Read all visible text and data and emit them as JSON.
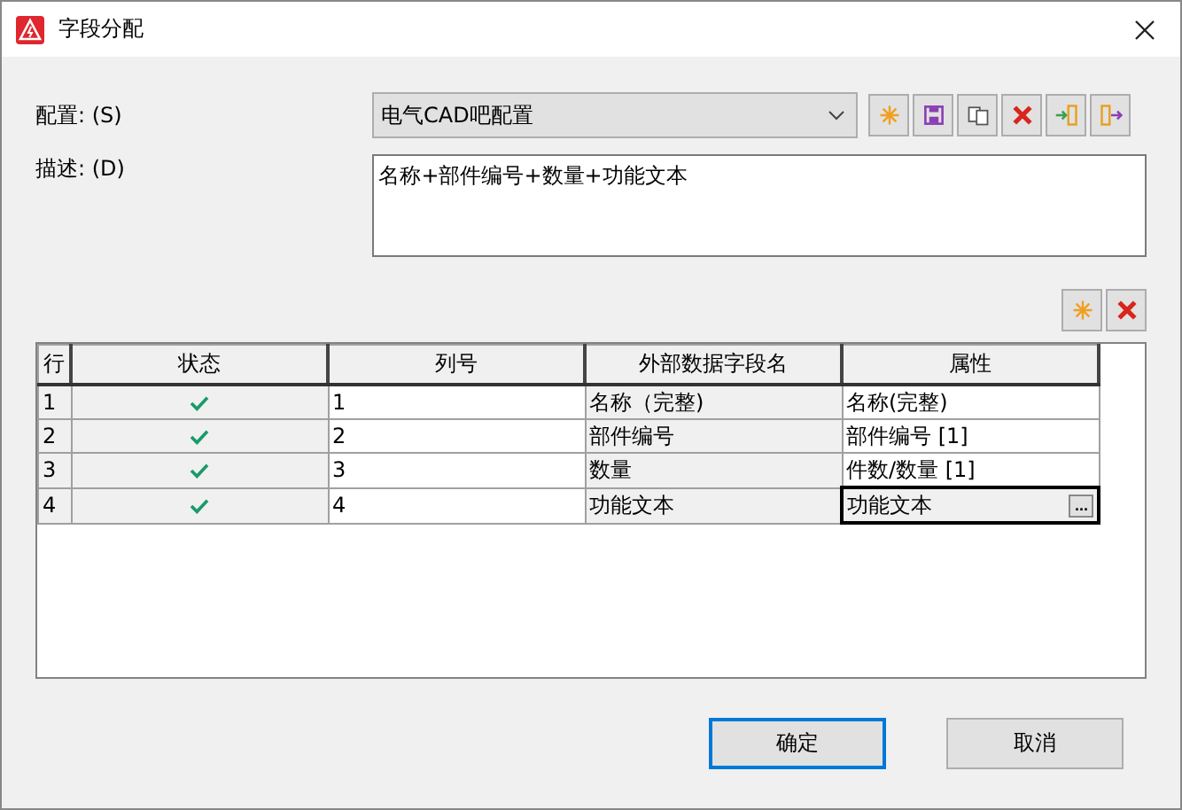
{
  "window": {
    "title": "字段分配"
  },
  "config": {
    "label": "配置: (S)",
    "value": "电气CAD吧配置"
  },
  "toolbar": [
    {
      "kind": "new"
    },
    {
      "kind": "save"
    },
    {
      "kind": "copy"
    },
    {
      "kind": "delete"
    },
    {
      "kind": "import"
    },
    {
      "kind": "export"
    }
  ],
  "description": {
    "label": "描述: (D)",
    "value": "名称+部件编号+数量+功能文本"
  },
  "table_toolbar": [
    {
      "kind": "new"
    },
    {
      "kind": "delete"
    }
  ],
  "table": {
    "columns": [
      "行",
      "状态",
      "列号",
      "外部数据字段名",
      "属性"
    ],
    "rows": [
      {
        "row": "1",
        "active": true,
        "column_no": "1",
        "field": "名称（完整)",
        "property": "名称(完整)",
        "selected": false
      },
      {
        "row": "2",
        "active": true,
        "column_no": "2",
        "field": "部件编号",
        "property": "部件编号 [1]",
        "selected": false
      },
      {
        "row": "3",
        "active": true,
        "column_no": "3",
        "field": "数量",
        "property": "件数/数量 [1]",
        "selected": false
      },
      {
        "row": "4",
        "active": true,
        "column_no": "4",
        "field": "功能文本",
        "property": "功能文本",
        "selected": true,
        "edit_button": "..."
      }
    ]
  },
  "buttons": [
    "确定",
    "取消"
  ]
}
